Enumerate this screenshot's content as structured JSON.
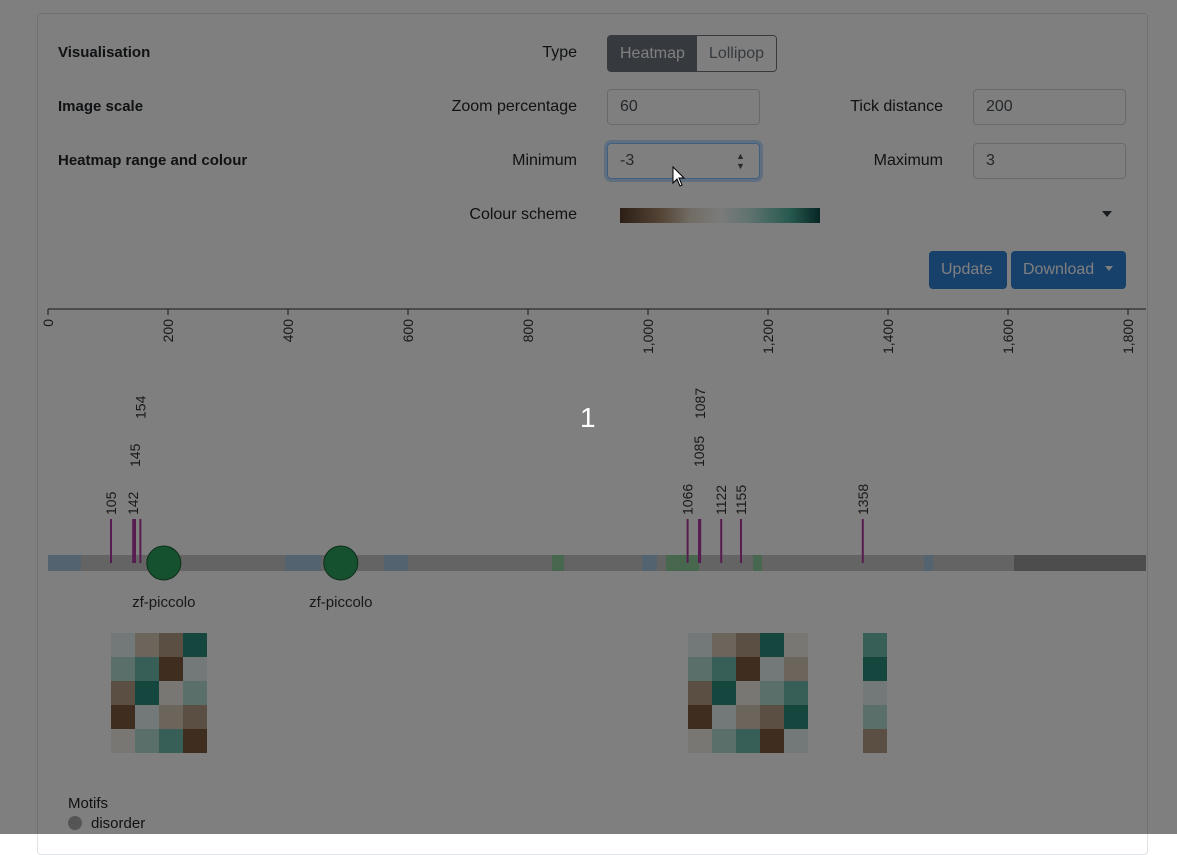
{
  "controls": {
    "visualisation_label": "Visualisation",
    "type_label": "Type",
    "type_options": [
      "Heatmap",
      "Lollipop"
    ],
    "type_selected": "Heatmap",
    "image_scale_label": "Image scale",
    "zoom_label": "Zoom percentage",
    "zoom_value": "60",
    "tick_label": "Tick distance",
    "tick_value": "200",
    "heatmap_label": "Heatmap range and colour",
    "minimum_label": "Minimum",
    "minimum_value": "-3",
    "maximum_label": "Maximum",
    "maximum_value": "3",
    "colour_scheme_label": "Colour scheme",
    "update_label": "Update",
    "download_label": "Download"
  },
  "axis": {
    "ticks": [
      "0",
      "200",
      "400",
      "600",
      "800",
      "1,000",
      "1,200",
      "1,400",
      "1,600",
      "1,800"
    ]
  },
  "sites": [
    105,
    142,
    145,
    154,
    1066,
    1085,
    1087,
    1122,
    1155,
    1358
  ],
  "domains": [
    {
      "label": "zf-piccolo",
      "pos": 193
    },
    {
      "label": "zf-piccolo",
      "pos": 488
    }
  ],
  "overlay": {
    "page_number": "1"
  },
  "legend": {
    "title": "Motifs",
    "items": [
      {
        "label": "disorder"
      }
    ]
  },
  "colors": {
    "accent": "#2f80d7",
    "domain": "#2ca25f",
    "site": "#b03aa0",
    "track": "#c8c8c8"
  }
}
